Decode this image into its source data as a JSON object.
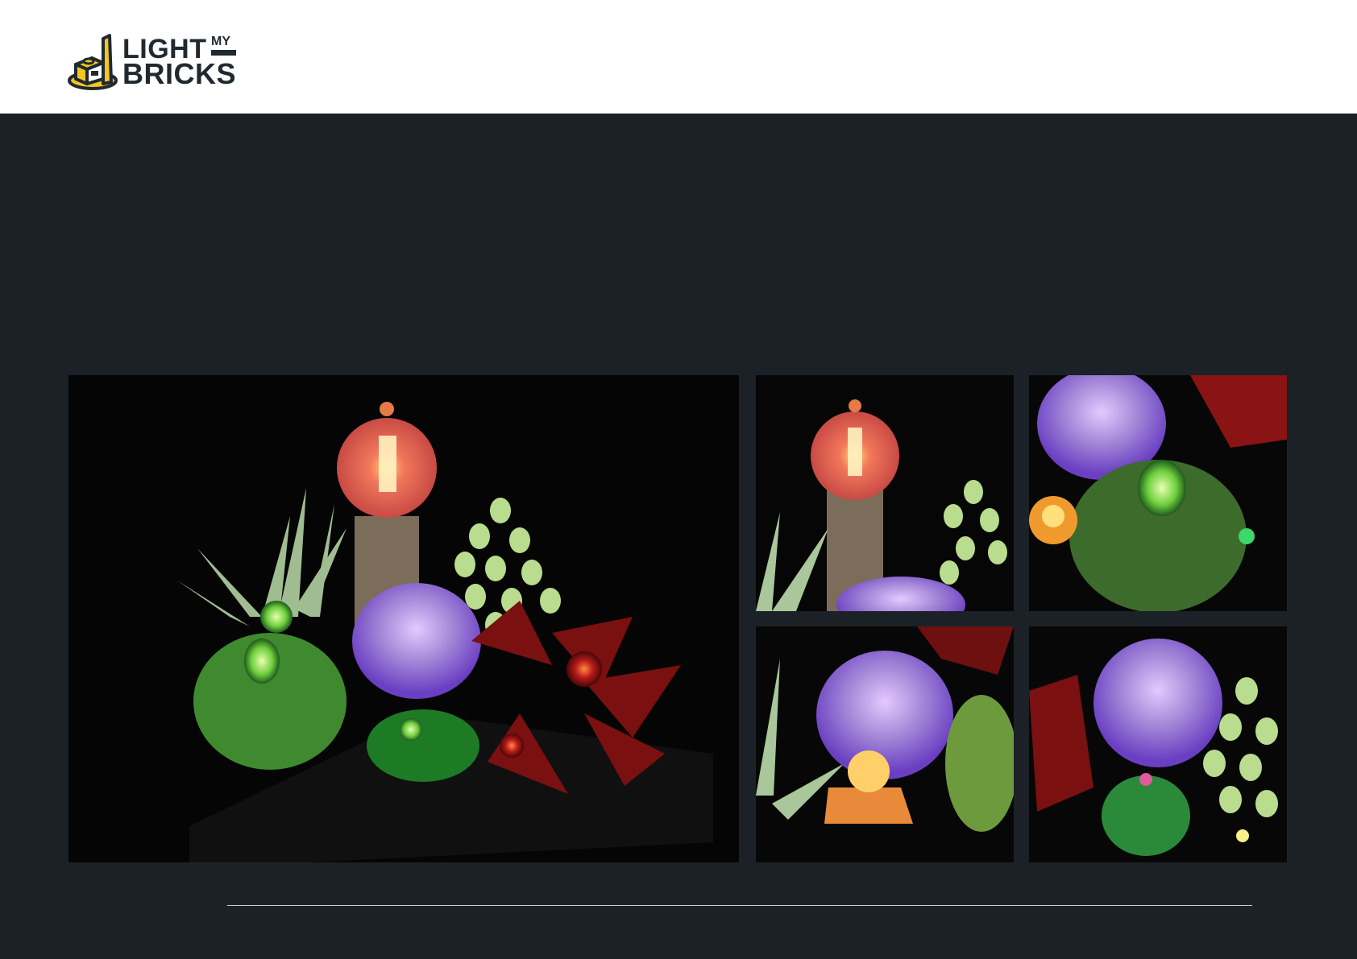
{
  "brand": {
    "line1": "LIGHT",
    "my": "MY",
    "line2": "BRICKS",
    "accent_color": "#f3c623",
    "text_color": "#1f2a30"
  },
  "colors": {
    "header_bg": "#ffffff",
    "page_bg": "#1b2127",
    "divider": "#c9cfd4"
  },
  "gallery": {
    "images": [
      {
        "name": "succulents-main-photo"
      },
      {
        "name": "pink-lantern-succulent-photo"
      },
      {
        "name": "green-succulent-closeup-photo"
      },
      {
        "name": "purple-bloom-orange-glow-photo"
      },
      {
        "name": "purple-bloom-cactus-photo"
      }
    ]
  }
}
